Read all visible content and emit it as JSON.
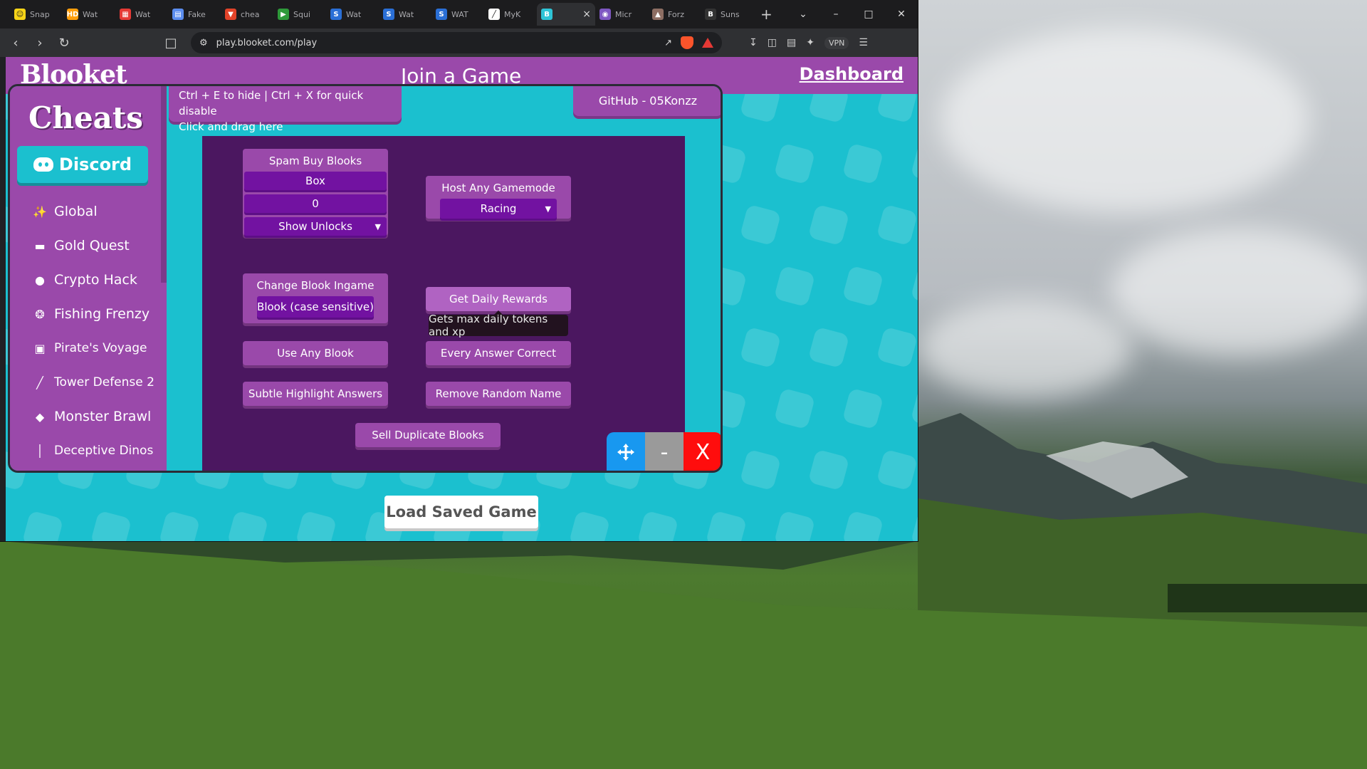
{
  "tabs": [
    {
      "label": "Snap",
      "color": "#f7d417",
      "glyph": "☺"
    },
    {
      "label": "Wat",
      "color": "#ff9e0b",
      "glyph": "HD"
    },
    {
      "label": "Wat",
      "color": "#e53935",
      "glyph": "▦"
    },
    {
      "label": "Fake",
      "color": "#5b8def",
      "glyph": "▤"
    },
    {
      "label": "chea",
      "color": "#e24329",
      "glyph": "▼"
    },
    {
      "label": "Squi",
      "color": "#2e9a3a",
      "glyph": "▶"
    },
    {
      "label": "Wat",
      "color": "#2a6fd6",
      "glyph": "S"
    },
    {
      "label": "Wat",
      "color": "#2a6fd6",
      "glyph": "S"
    },
    {
      "label": "WAT",
      "color": "#2a6fd6",
      "glyph": "S"
    },
    {
      "label": "MyK",
      "color": "#ffffff",
      "glyph": "╱"
    }
  ],
  "active_tab": {
    "glyph": "B",
    "color": "#2ec4d6"
  },
  "tabs_after": [
    {
      "label": "Micr",
      "color": "#7e57c2",
      "glyph": "◉"
    },
    {
      "label": "Forz",
      "color": "#8d6e63",
      "glyph": "▲"
    },
    {
      "label": "Suns",
      "color": "#333333",
      "glyph": "B"
    }
  ],
  "browser": {
    "url": "play.blooket.com/play",
    "vpn_label": "VPN"
  },
  "page": {
    "logo": "Blooket",
    "title": "Join a Game",
    "dashboard": "Dashboard",
    "load_saved_game": "Load Saved Game"
  },
  "gui": {
    "title": "Cheats",
    "discord": "Discord",
    "hint_line1": "Ctrl + E to hide | Ctrl + X for quick disable",
    "hint_line2": "Click and drag here",
    "github": "GitHub - 05Konzz",
    "modes": [
      {
        "label": "Global",
        "icon": "✨"
      },
      {
        "label": "Gold Quest",
        "icon": "▬"
      },
      {
        "label": "Crypto Hack",
        "icon": "●"
      },
      {
        "label": "Fishing Frenzy",
        "icon": "❂"
      },
      {
        "label": "Pirate's Voyage",
        "icon": "▣"
      },
      {
        "label": "Tower Defense 2",
        "icon": "╱"
      },
      {
        "label": "Monster Brawl",
        "icon": "◆"
      },
      {
        "label": "Deceptive Dinos",
        "icon": "│"
      }
    ],
    "spam_buy": {
      "title": "Spam Buy Blooks",
      "box": "Box",
      "amount": "0",
      "unlocks": "Show Unlocks"
    },
    "host_mode": {
      "title": "Host Any Gamemode",
      "value": "Racing"
    },
    "change_blook": {
      "title": "Change Blook Ingame",
      "placeholder": "Blook (case sensitive)"
    },
    "buttons": {
      "daily": "Get Daily Rewards",
      "daily_tooltip": "Gets max daily tokens and xp",
      "use_any": "Use Any Blook",
      "every_correct": "Every Answer Correct",
      "highlight": "Subtle Highlight Answers",
      "remove_name": "Remove Random Name",
      "sell_dupes": "Sell Duplicate Blooks"
    },
    "controls": {
      "move_icon": "move-icon",
      "minimize": "-",
      "close": "X"
    }
  }
}
